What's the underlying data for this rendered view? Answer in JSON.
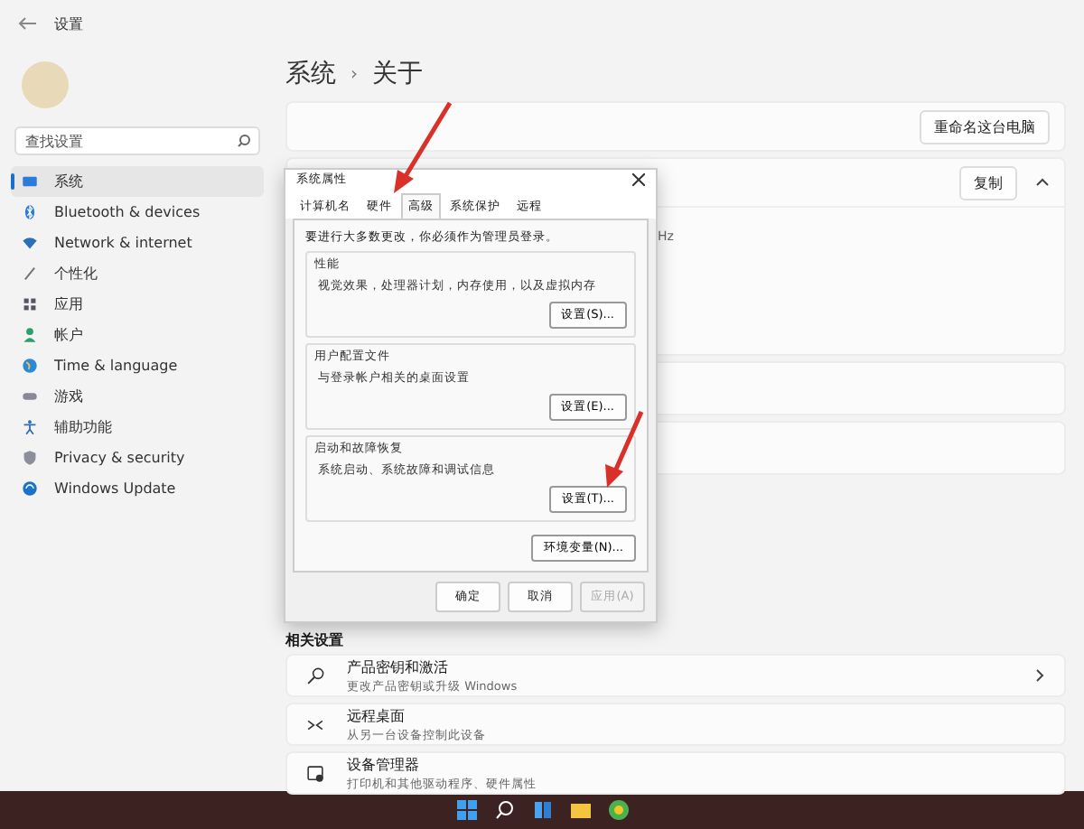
{
  "window": {
    "title": "设置"
  },
  "search": {
    "placeholder": "查找设置"
  },
  "sidebar": {
    "items": [
      {
        "label": "系统",
        "selected": true
      },
      {
        "label": "Bluetooth & devices",
        "selected": false
      },
      {
        "label": "Network & internet",
        "selected": false
      },
      {
        "label": "个性化",
        "selected": false
      },
      {
        "label": "应用",
        "selected": false
      },
      {
        "label": "帐户",
        "selected": false
      },
      {
        "label": "Time & language",
        "selected": false
      },
      {
        "label": "游戏",
        "selected": false
      },
      {
        "label": "辅助功能",
        "selected": false
      },
      {
        "label": "Privacy & security",
        "selected": false
      },
      {
        "label": "Windows Update",
        "selected": false
      }
    ]
  },
  "breadcrumb": {
    "parent": "系统",
    "separator": "›",
    "current": "关于"
  },
  "rename_button": "重命名这台电脑",
  "copy_button": "复制",
  "spec_fragment": "Hz",
  "dialog": {
    "title": "系统属性",
    "tabs": [
      {
        "label": "计算机名",
        "selected": false
      },
      {
        "label": "硬件",
        "selected": false
      },
      {
        "label": "高级",
        "selected": true
      },
      {
        "label": "系统保护",
        "selected": false
      },
      {
        "label": "远程",
        "selected": false
      }
    ],
    "notice": "要进行大多数更改，你必须作为管理员登录。",
    "groups": [
      {
        "title": "性能",
        "text": "视觉效果，处理器计划，内存使用，以及虚拟内存",
        "button": "设置(S)..."
      },
      {
        "title": "用户配置文件",
        "text": "与登录帐户相关的桌面设置",
        "button": "设置(E)..."
      },
      {
        "title": "启动和故障恢复",
        "text": "系统启动、系统故障和调试信息",
        "button": "设置(T)..."
      }
    ],
    "env_button": "环境变量(N)...",
    "buttons": [
      {
        "label": "确定",
        "disabled": false
      },
      {
        "label": "取消",
        "disabled": false
      },
      {
        "label": "应用(A)",
        "disabled": true
      }
    ]
  },
  "related": {
    "title": "相关设置",
    "items": [
      {
        "title": "产品密钥和激活",
        "subtitle": "更改产品密钥或升级 Windows",
        "chevron": true
      },
      {
        "title": "远程桌面",
        "subtitle": "从另一台设备控制此设备",
        "chevron": false
      },
      {
        "title": "设备管理器",
        "subtitle": "打印机和其他驱动程序、硬件属性",
        "chevron": false
      }
    ]
  }
}
